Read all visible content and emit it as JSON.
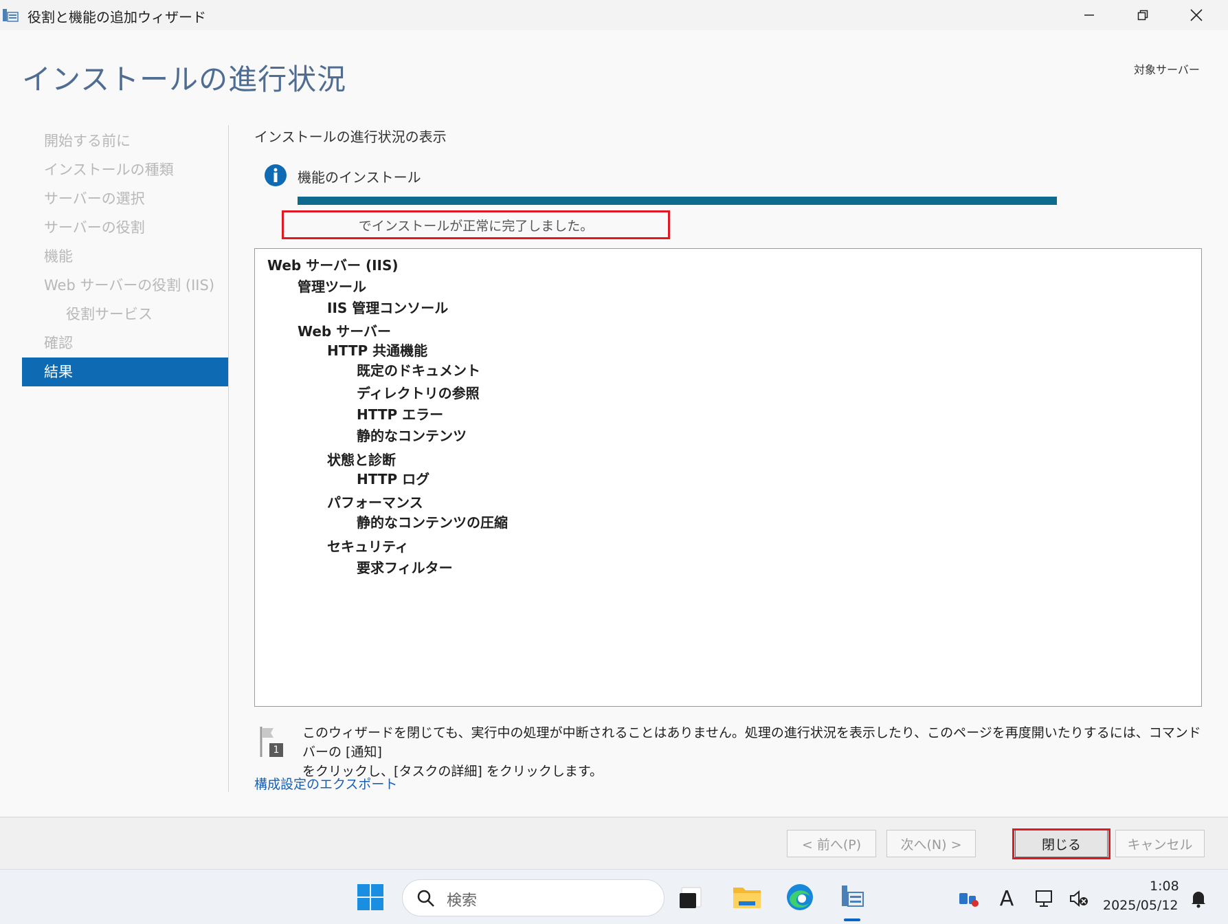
{
  "window": {
    "title": "役割と機能の追加ウィザード",
    "page_title": "インストールの進行状況",
    "target_server_label": "対象サーバー"
  },
  "nav": {
    "items": [
      {
        "label": "開始する前に",
        "state": "disabled"
      },
      {
        "label": "インストールの種類",
        "state": "disabled"
      },
      {
        "label": "サーバーの選択",
        "state": "disabled"
      },
      {
        "label": "サーバーの役割",
        "state": "disabled"
      },
      {
        "label": "機能",
        "state": "disabled"
      },
      {
        "label": "Web サーバーの役割 (IIS)",
        "state": "disabled"
      },
      {
        "label": "役割サービス",
        "state": "disabled",
        "sub": true
      },
      {
        "label": "確認",
        "state": "disabled"
      },
      {
        "label": "結果",
        "state": "active"
      }
    ]
  },
  "content": {
    "section_heading": "インストールの進行状況の表示",
    "install_label": "機能のインストール",
    "progress_fraction": 1.0,
    "status_message": "でインストールが正常に完了しました。",
    "results": [
      {
        "label": "Web サーバー (IIS)",
        "level": 0
      },
      {
        "label": "管理ツール",
        "level": 1
      },
      {
        "label": "IIS 管理コンソール",
        "level": 2
      },
      {
        "label": "Web サーバー",
        "level": 1
      },
      {
        "label": "HTTP 共通機能",
        "level": 2
      },
      {
        "label": "既定のドキュメント",
        "level": 3
      },
      {
        "label": "ディレクトリの参照",
        "level": 3
      },
      {
        "label": "HTTP エラー",
        "level": 3
      },
      {
        "label": "静的なコンテンツ",
        "level": 3
      },
      {
        "label": "状態と診断",
        "level": 2
      },
      {
        "label": "HTTP ログ",
        "level": 3
      },
      {
        "label": "パフォーマンス",
        "level": 2
      },
      {
        "label": "静的なコンテンツの圧縮",
        "level": 3
      },
      {
        "label": "セキュリティ",
        "level": 2
      },
      {
        "label": "要求フィルター",
        "level": 3
      }
    ],
    "note_line1": "このウィザードを閉じても、実行中の処理が中断されることはありません。処理の進行状況を表示したり、このページを再度開いたりするには、コマンド バーの [通知]",
    "note_line2": "をクリックし、[タスクの詳細] をクリックします。",
    "note_badge": "1",
    "export_link": "構成設定のエクスポート"
  },
  "footer": {
    "prev_label": "< 前へ(P)",
    "next_label": "次へ(N) >",
    "close_label": "閉じる",
    "cancel_label": "キャンセル"
  },
  "taskbar": {
    "search_placeholder": "検索",
    "time": "1:08",
    "date": "2025/05/12",
    "ime_indicator": "A"
  },
  "colors": {
    "accent": "#0d6ab3",
    "progress": "#0f6b8e",
    "highlight": "#e01a22",
    "title": "#4f6d93"
  }
}
